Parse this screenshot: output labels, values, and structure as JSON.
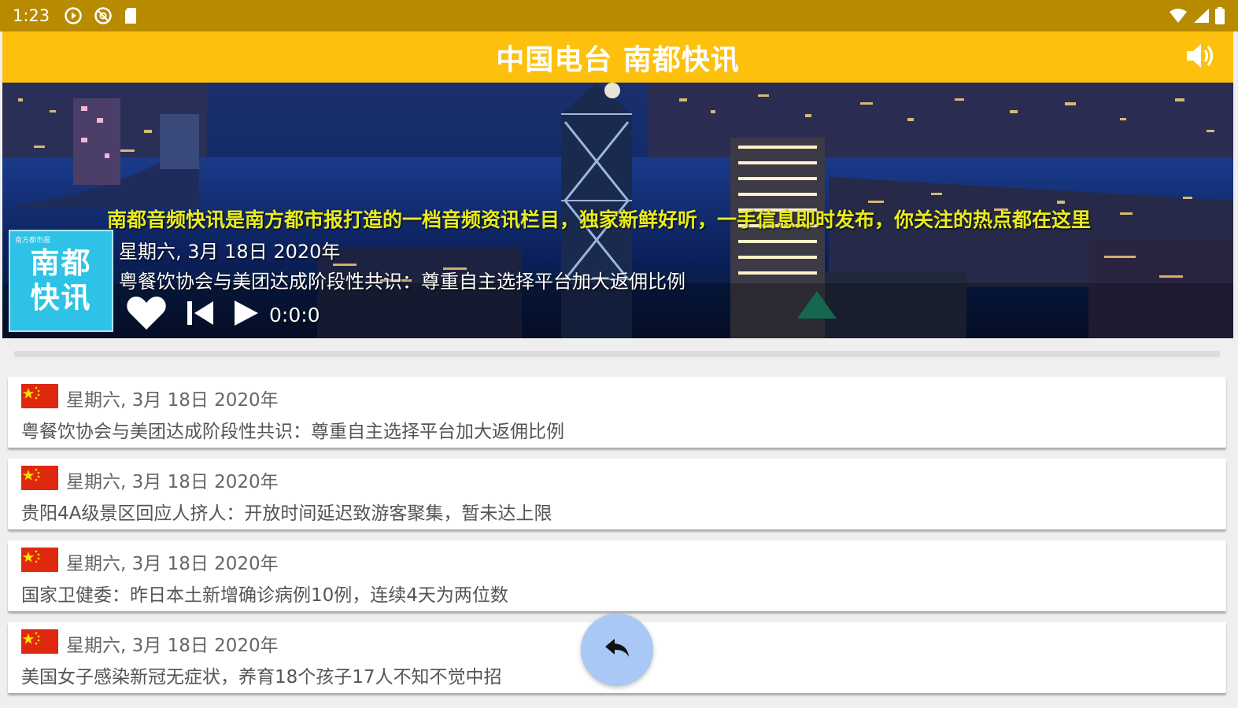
{
  "status_bar": {
    "time": "1:23",
    "icons": [
      "media-play-icon",
      "vpn-icon",
      "sd-card-icon",
      "wifi-icon",
      "signal-icon",
      "battery-icon"
    ]
  },
  "app_bar": {
    "title": "中国电台 南都快讯",
    "volume_icon": "volume-icon",
    "background": "#fdc00c"
  },
  "banner": {
    "marquee": "南都音频快讯是南方都市报打造的一档音频资讯栏目，独家新鲜好听，一手信息即时发布，你关注的热点都在这里",
    "logo_small": "南方都市报",
    "logo_line1": "南都",
    "logo_line2": "快讯",
    "date": "星期六, 3月 18日 2020年",
    "headline": "粤餐饮协会与美团达成阶段性共识：尊重自主选择平台加大返佣比例",
    "time": "0:0:0",
    "controls": [
      "heart-icon",
      "skip-previous-icon",
      "play-icon"
    ]
  },
  "news": [
    {
      "date": "星期六, 3月 18日 2020年",
      "title": "粤餐饮协会与美团达成阶段性共识：尊重自主选择平台加大返佣比例"
    },
    {
      "date": "星期六, 3月 18日 2020年",
      "title": "贵阳4A级景区回应人挤人：开放时间延迟致游客聚集，暂未达上限"
    },
    {
      "date": "星期六, 3月 18日 2020年",
      "title": "国家卫健委：昨日本土新增确诊病例10例，连续4天为两位数"
    },
    {
      "date": "星期六, 3月 18日 2020年",
      "title": "美国女子感染新冠无症状，养育18个孩子17人不知不觉中招"
    }
  ],
  "fab": {
    "icon": "reply-back-icon"
  }
}
